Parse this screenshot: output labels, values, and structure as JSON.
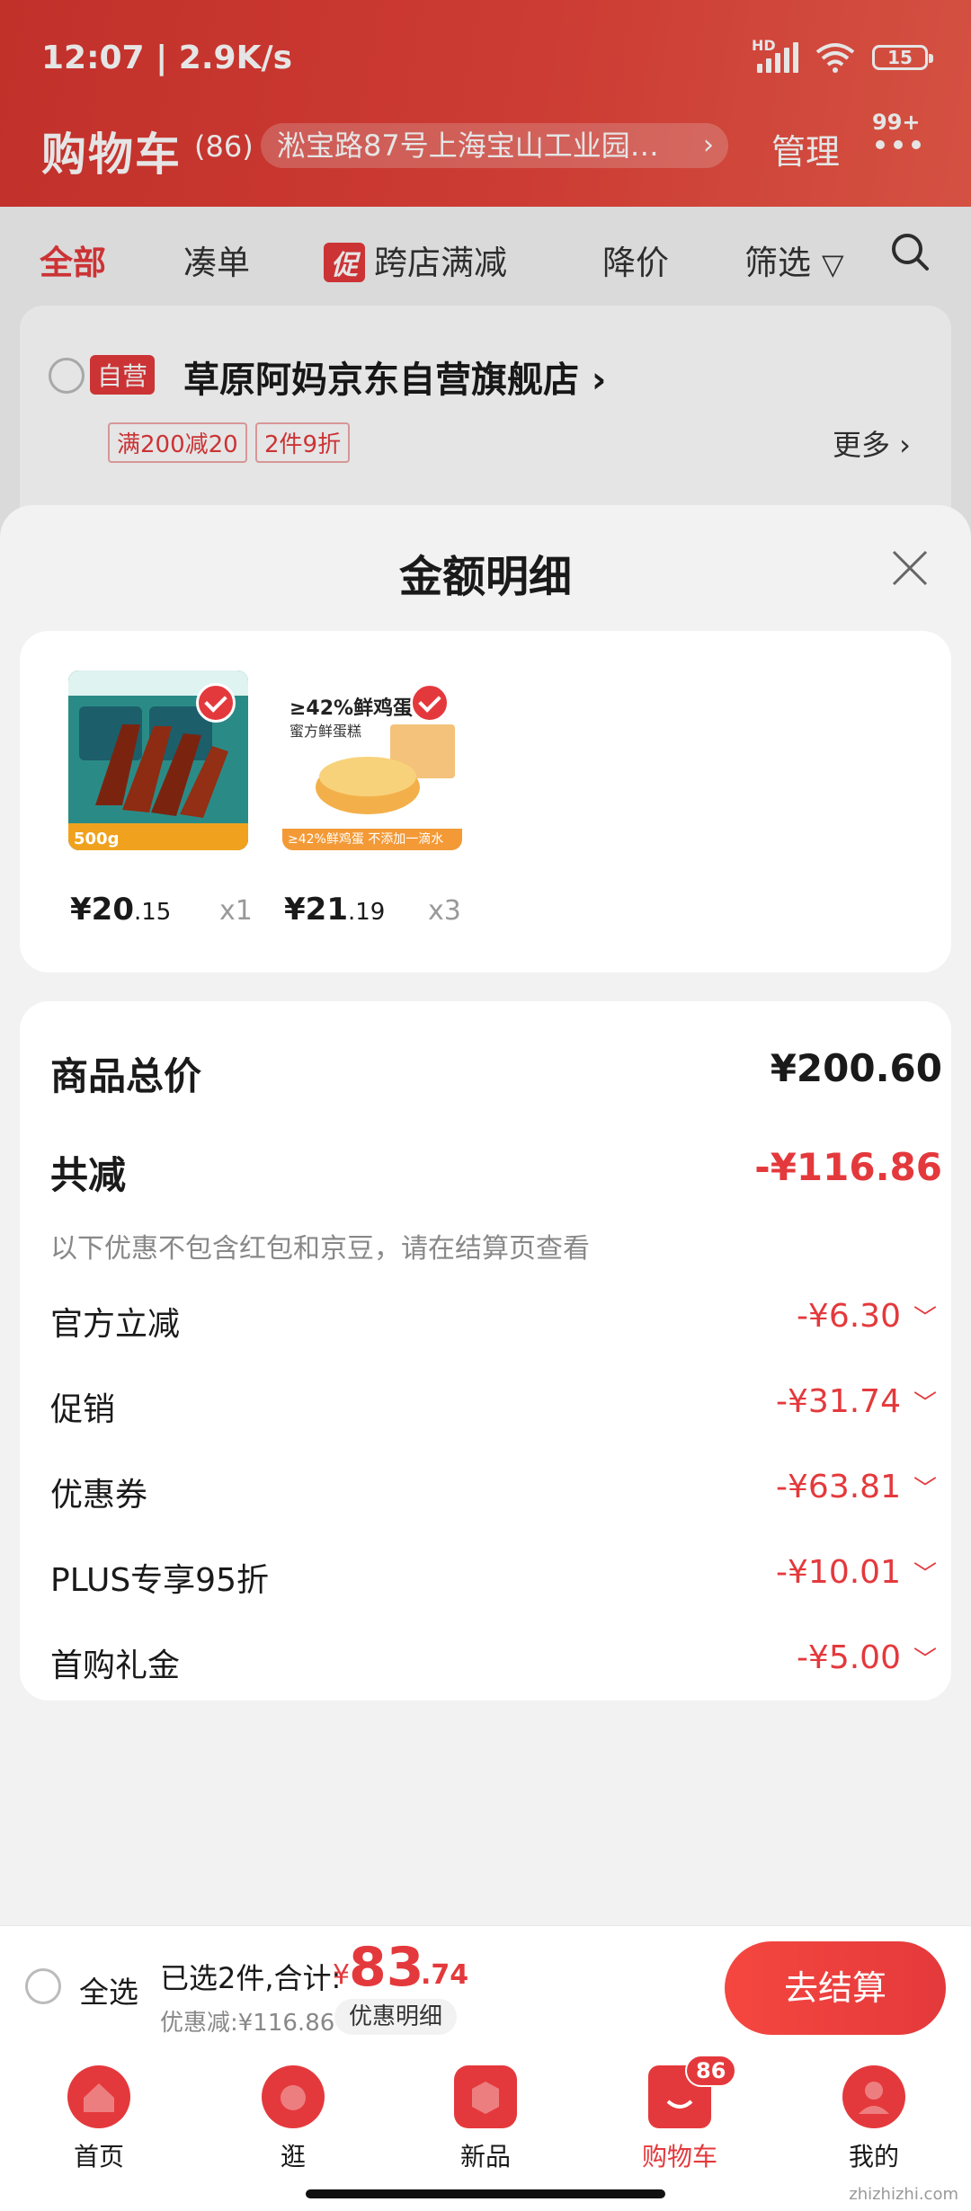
{
  "status_bar": {
    "time": "12:07 | 2.9K/s",
    "network": "HD",
    "battery": "15"
  },
  "header": {
    "title": "购物车",
    "count": "(86)",
    "address": "淞宝路87号上海宝山工业园…",
    "manage": "管理",
    "message_badge": "99+"
  },
  "filters": {
    "all": "全部",
    "combine": "凑单",
    "promo_tag": "促",
    "cross_store": "跨店满减",
    "price_drop": "降价",
    "filter": "筛选"
  },
  "store": {
    "self_tag": "自营",
    "name": "草原阿妈京东自营旗舰店 ›",
    "coupons": [
      "满200减20",
      "2件9折"
    ],
    "more": "更多 ›"
  },
  "sheet": {
    "title": "金额明细",
    "products": [
      {
        "price_main": "¥20",
        "price_dec": ".15",
        "qty": "x1"
      },
      {
        "price_main": "¥21",
        "price_dec": ".19",
        "qty": "x3"
      }
    ],
    "product2_badge": "≥42%鲜鸡蛋",
    "product2_sub": "蜜方鲜蛋糕",
    "product2_strip": "≥42%鲜鸡蛋 不添加一滴水",
    "product1_weight": "500g",
    "summary": {
      "total_label": "商品总价",
      "total_value": "¥200.60",
      "reduce_label": "共减",
      "reduce_value": "-¥116.86",
      "note": "以下优惠不包含红包和京豆，请在结算页查看",
      "items": [
        {
          "label": "官方立减",
          "value": "-¥6.30"
        },
        {
          "label": "促销",
          "value": "-¥31.74"
        },
        {
          "label": "优惠券",
          "value": "-¥63.81"
        },
        {
          "label": "PLUS专享95折",
          "value": "-¥10.01"
        },
        {
          "label": "首购礼金",
          "value": "-¥5.00"
        }
      ]
    }
  },
  "checkout": {
    "select_all": "全选",
    "selected": "已选2件,合计:",
    "yen": "¥",
    "total_main": "83",
    "total_dec": ".74",
    "discount": "优惠减:¥116.86",
    "detail_button": "优惠明细",
    "checkout_button": "去结算"
  },
  "tabbar": {
    "items": [
      {
        "label": "首页"
      },
      {
        "label": "逛"
      },
      {
        "label": "新品"
      },
      {
        "label": "购物车"
      },
      {
        "label": "我的"
      }
    ],
    "cart_badge": "86"
  },
  "watermark": "zhizhizhi.com",
  "colors": {
    "accent": "#e4393c",
    "header": "#e0403a"
  }
}
